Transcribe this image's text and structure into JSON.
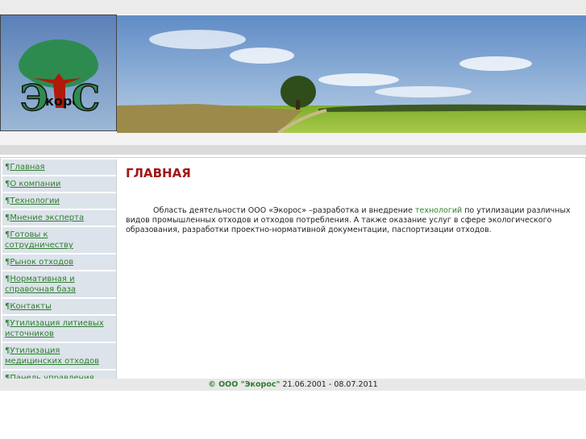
{
  "logo": {
    "text_left": "Э",
    "text_mid": "коро",
    "text_right": "С"
  },
  "nav": [
    "Главная",
    "О компании",
    "Технологии",
    "Мнение эксперта",
    "Готовы к   сотрудничеству",
    "Рынок отходов",
    "Нормативная и справочная   база",
    "Контакты",
    "Утилизация литиевых источников",
    "Утилизация медицинских отходов",
    "Панель управления"
  ],
  "nav_marker": "¶",
  "page": {
    "title": "ГЛАВНАЯ",
    "text_1": "Область деятельности ООО «Экорос» –разработка и внедрение ",
    "link": "технологий",
    "text_2": " по утилизации различных видов промышленных отходов и отходов потребления.            А также оказание услуг в сфере экологического образования, разработки проектно-нормативной документации, паспортизации отходов."
  },
  "footer": {
    "link": "© ООО \"Экорос\"",
    "dates": " 21.06.2001 - 08.07.2011"
  }
}
